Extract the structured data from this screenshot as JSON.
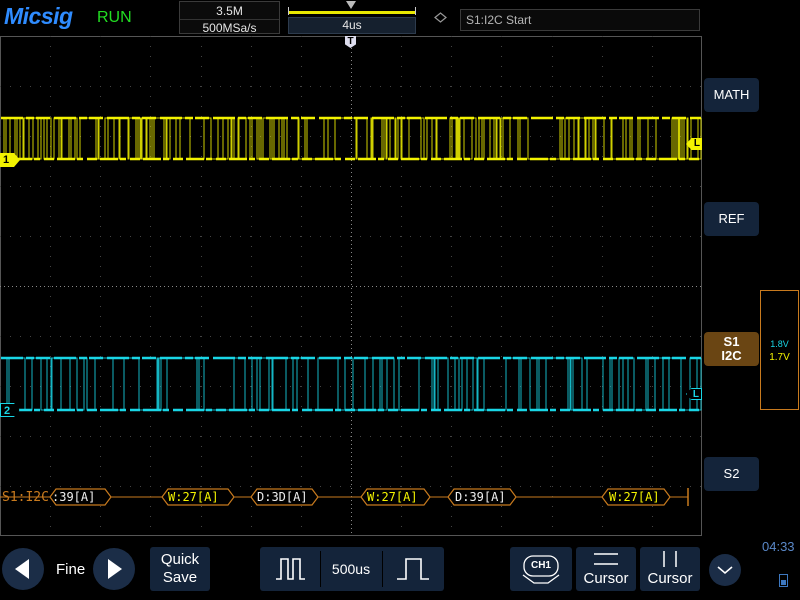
{
  "header": {
    "brand": "Micsig",
    "run_state": "RUN",
    "memory_depth": "3.5M",
    "sample_rate": "500MSa/s",
    "timebase": "4us",
    "trigger_info": "S1:I2C Start"
  },
  "markers": {
    "ch1": "1",
    "ch2": "2",
    "level": "L",
    "trigger": "T"
  },
  "decode": {
    "bus_label": "S1:I2C",
    "frames": [
      {
        "text": ":39[A]",
        "color": "#f0f0f0"
      },
      {
        "text": "W:27[A]",
        "color": "#f3f300"
      },
      {
        "text": "D:3D[A]",
        "color": "#f0f0f0"
      },
      {
        "text": "W:27[A]",
        "color": "#f3f300"
      },
      {
        "text": "D:39[A]",
        "color": "#f0f0f0"
      },
      {
        "text": "W:27[A]",
        "color": "#f3f300"
      }
    ]
  },
  "side_panel": {
    "math": "MATH",
    "ref": "REF",
    "s1_line1": "S1",
    "s1_line2": "I2C",
    "s2": "S2",
    "threshold_ch2": "1.8V",
    "threshold_ch1": "1.7V"
  },
  "footer": {
    "fine": "Fine",
    "quick_save_line1": "Quick",
    "quick_save_line2": "Save",
    "timebase_value": "500us",
    "ch1_chip": "CH1",
    "cursor1": "Cursor",
    "cursor2": "Cursor",
    "clock": "04:33"
  },
  "colors": {
    "ch1": "#f3f300",
    "ch2": "#19d6e6",
    "decode": "#c87a1e",
    "button_bg": "#14243a"
  },
  "icons": [
    "left-arrow-icon",
    "right-arrow-icon",
    "pulse-wide-icon",
    "pulse-narrow-icon",
    "cursor-horizontal-icon",
    "cursor-vertical-icon",
    "chevron-down-icon",
    "battery-icon",
    "diamond-icon"
  ]
}
